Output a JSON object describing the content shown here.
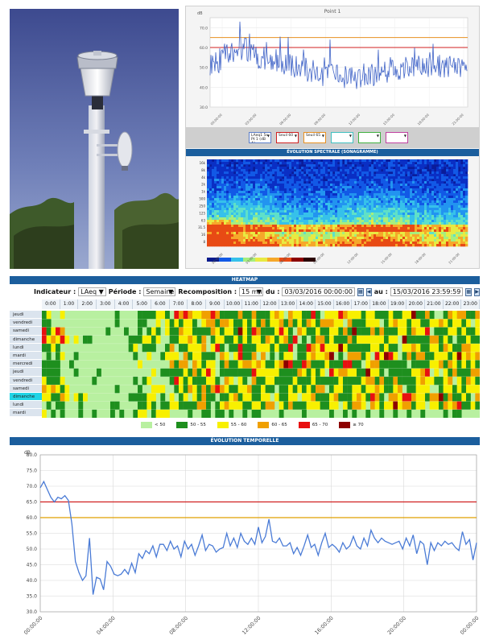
{
  "point_panel": {
    "title": "Point 1",
    "y_unit": "dB",
    "y_ticks": [
      "70.0",
      "60.0",
      "50.0",
      "40.0",
      "30.0"
    ],
    "x_ticks": [
      "00:00:00",
      "03:00:00",
      "06:00:00",
      "09:00:00",
      "12:00:00",
      "15:00:00",
      "18:00:00",
      "21:00:00"
    ],
    "selectors": [
      {
        "label": "LAeq1 5s",
        "sub": "Pt 1 (dB A)",
        "color": "#5b7ec9"
      },
      {
        "label": "Seuil 60",
        "sub": "",
        "color": "#d02020"
      },
      {
        "label": "Seuil 65",
        "sub": "",
        "color": "#e89020"
      },
      {
        "label": "",
        "sub": "",
        "color": "#40c0c0"
      },
      {
        "label": "",
        "sub": "",
        "color": "#40b040"
      },
      {
        "label": "",
        "sub": "",
        "color": "#c040a0"
      }
    ],
    "spectral_title": "ÉVOLUTION SPECTRALE (SONAGRAMME)",
    "freq_ticks": [
      "16k",
      "8k",
      "4k",
      "2k",
      "1k",
      "500",
      "250",
      "125",
      "63",
      "31.5",
      "16",
      "8"
    ]
  },
  "heatmap": {
    "title": "HEATMAP",
    "indicator_label": "Indicateur :",
    "indicator_value": "LAeq",
    "period_label": "Période :",
    "period_value": "Semaine",
    "recomp_label": "Recomposition :",
    "recomp_value": "15 mn",
    "from_label": "du :",
    "from_value": "03/03/2016 00:00:00",
    "to_label": "au :",
    "to_value": "15/03/2016 23:59:59",
    "hours": [
      "0:00",
      "1:00",
      "2:00",
      "3:00",
      "4:00",
      "5:00",
      "6:00",
      "7:00",
      "8:00",
      "9:00",
      "10:00",
      "11:00",
      "12:00",
      "13:00",
      "14:00",
      "15:00",
      "16:00",
      "17:00",
      "18:00",
      "19:00",
      "20:00",
      "21:00",
      "22:00",
      "23:00"
    ],
    "days": [
      "jeudi",
      "vendredi",
      "samedi",
      "dimanche",
      "lundi",
      "mardi",
      "mercredi",
      "jeudi",
      "vendredi",
      "samedi",
      "dimanche",
      "lundi",
      "mardi"
    ],
    "selected_day_index": 10,
    "legend": [
      {
        "label": "< 50",
        "color": "#b8f0a0"
      },
      {
        "label": "50 - 55",
        "color": "#1e8f1e"
      },
      {
        "label": "55 - 60",
        "color": "#f8f000"
      },
      {
        "label": "60 - 65",
        "color": "#f0a000"
      },
      {
        "label": "65 - 70",
        "color": "#e81010"
      },
      {
        "label": "≥ 70",
        "color": "#8c0000"
      }
    ]
  },
  "evolution": {
    "title": "ÉVOLUTION TEMPORELLE",
    "y_unit": "dB",
    "y_ticks": [
      "80.0",
      "75.0",
      "70.0",
      "65.0",
      "60.0",
      "55.0",
      "50.0",
      "45.0",
      "40.0",
      "35.0",
      "30.0"
    ],
    "x_ticks": [
      "00:00:00",
      "04:00:00",
      "08:00:00",
      "12:00:00",
      "16:00:00",
      "20:00:00",
      "00:00:00"
    ]
  },
  "chart_data": [
    {
      "type": "line",
      "title": "ÉVOLUTION TEMPORELLE",
      "xlabel": "",
      "ylabel": "dB",
      "ylim": [
        30,
        80
      ],
      "x_range_hours": [
        0,
        24
      ],
      "grid": true,
      "thresholds": [
        {
          "value": 65,
          "color": "#d02020"
        },
        {
          "value": 60,
          "color": "#e0a000"
        }
      ],
      "series": [
        {
          "values": [
            69.5,
            71.5,
            69.0,
            66.5,
            65.0,
            66.5,
            66.0,
            67.0,
            65.5,
            58.0,
            46.0,
            42.5,
            40.0,
            41.5,
            53.5,
            35.5,
            41.0,
            40.5,
            37.0,
            46.0,
            44.5,
            42.0,
            41.5,
            42.0,
            43.5,
            42.0,
            45.5,
            42.5,
            48.5,
            47.0,
            49.5,
            48.5,
            51.0,
            47.5,
            51.5,
            51.5,
            49.5,
            52.5,
            50.0,
            51.0,
            47.5,
            52.5,
            50.0,
            51.5,
            48.0,
            51.0,
            54.5,
            49.5,
            51.5,
            51.0,
            49.0,
            50.0,
            50.5,
            55.0,
            51.0,
            53.5,
            50.5,
            55.0,
            52.5,
            51.5,
            53.5,
            51.5,
            57.0,
            52.0,
            54.0,
            59.5,
            52.5,
            52.0,
            53.5,
            51.0,
            51.0,
            52.0,
            48.5,
            50.5,
            48.0,
            51.0,
            54.5,
            50.5,
            51.5,
            48.0,
            52.0,
            55.0,
            50.5,
            51.5,
            50.5,
            49.0,
            52.0,
            50.0,
            51.0,
            54.0,
            51.0,
            50.0,
            53.5,
            51.0,
            56.0,
            53.5,
            52.0,
            53.5,
            52.5,
            52.0,
            51.5,
            52.0,
            52.5,
            50.0,
            53.5,
            51.0,
            54.5,
            48.5,
            52.5,
            51.5,
            45.0,
            52.0,
            49.5,
            52.0,
            51.0,
            52.5,
            51.5,
            52.0,
            50.5,
            49.5,
            55.5,
            51.5,
            53.0,
            46.5,
            52.0
          ]
        }
      ]
    },
    {
      "type": "line",
      "title": "Point 1",
      "ylabel": "dB",
      "ylim": [
        30,
        75
      ],
      "thresholds": [
        {
          "value": 60,
          "color": "#d02020"
        },
        {
          "value": 65,
          "color": "#e89020"
        }
      ],
      "series": [
        {
          "name": "LAeq1 5s",
          "values": []
        }
      ]
    },
    {
      "type": "heatmap",
      "title": "HEATMAP",
      "rows": [
        "jeudi",
        "vendredi",
        "samedi",
        "dimanche",
        "lundi",
        "mardi",
        "mercredi",
        "jeudi",
        "vendredi",
        "samedi",
        "dimanche",
        "lundi",
        "mardi"
      ],
      "columns": "0:00 to 23:45, 15 mn steps",
      "value_classes": [
        "< 50",
        "50 - 55",
        "55 - 60",
        "60 - 65",
        "65 - 70",
        "≥ 70"
      ]
    }
  ]
}
